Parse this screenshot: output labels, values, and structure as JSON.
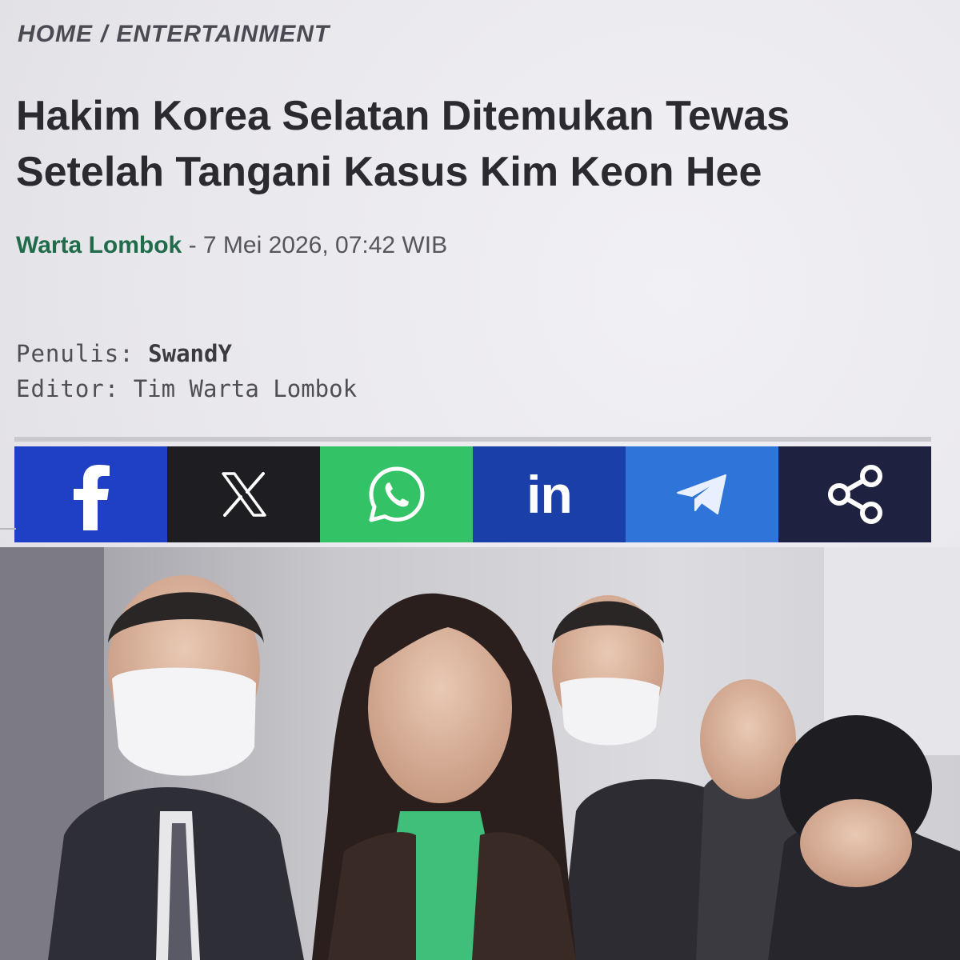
{
  "breadcrumb": {
    "home": "HOME",
    "separator": "/",
    "category": "ENTERTAINMENT"
  },
  "article": {
    "title_line1": "Hakim Korea Selatan Ditemukan Tewas",
    "title_line2": "Setelah Tangani Kasus Kim Keon Hee",
    "publisher": "Warta Lombok",
    "date_separator": " - ",
    "datetime": "7 Mei 2026, 07:42 WIB",
    "writer_label": "Penulis:",
    "writer": "SwandY",
    "editor_label": "Editor:",
    "editor": "Tim Warta Lombok"
  },
  "share": {
    "buttons": [
      {
        "id": "facebook",
        "icon": "facebook-icon",
        "color": "#1f3fc4"
      },
      {
        "id": "x",
        "icon": "x-icon",
        "color": "#1e1e22"
      },
      {
        "id": "whatsapp",
        "icon": "whatsapp-icon",
        "color": "#33c366"
      },
      {
        "id": "linkedin",
        "icon": "linkedin-icon",
        "label": "in",
        "color": "#1b3fa8"
      },
      {
        "id": "telegram",
        "icon": "telegram-icon",
        "color": "#2f74d8"
      },
      {
        "id": "share",
        "icon": "share-icon",
        "color": "#1e2140"
      }
    ]
  },
  "hero_image": {
    "subject": "photo"
  }
}
